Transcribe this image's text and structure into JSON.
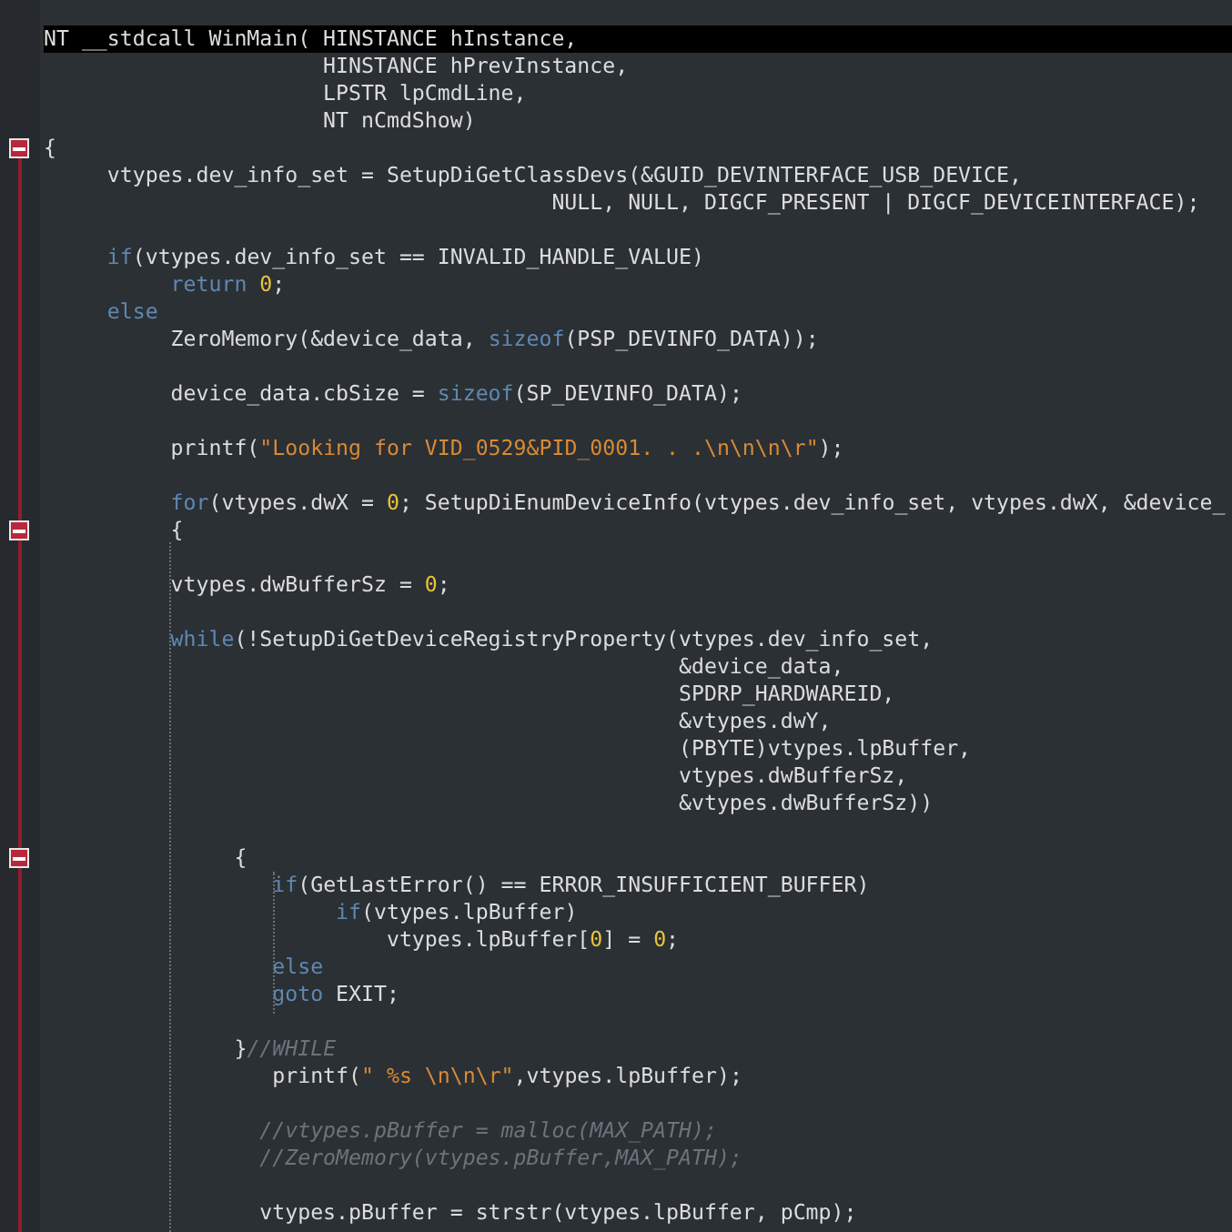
{
  "editor": {
    "lines": [
      {
        "kind": "code",
        "fold": false,
        "current": true,
        "tokens": [
          {
            "kind": "text",
            "text": "NT __stdcall WinMain( HINSTANCE hInstance,"
          }
        ]
      },
      {
        "kind": "code",
        "fold": false,
        "current": false,
        "tokens": [
          {
            "kind": "text",
            "text": "                      HINSTANCE hPrevInstance,"
          }
        ]
      },
      {
        "kind": "code",
        "fold": false,
        "current": false,
        "tokens": [
          {
            "kind": "text",
            "text": "                      LPSTR lpCmdLine,"
          }
        ]
      },
      {
        "kind": "code",
        "fold": false,
        "current": false,
        "tokens": [
          {
            "kind": "text",
            "text": "                      NT nCmdShow)"
          }
        ]
      },
      {
        "kind": "code",
        "fold": true,
        "current": false,
        "tokens": [
          {
            "kind": "text",
            "text": "{"
          }
        ]
      },
      {
        "kind": "code",
        "fold": false,
        "current": false,
        "tokens": [
          {
            "kind": "text",
            "text": "     vtypes.dev_info_set = SetupDiGetClassDevs(&GUID_DEVINTERFACE_USB_DEVICE,"
          }
        ]
      },
      {
        "kind": "code",
        "fold": false,
        "current": false,
        "tokens": [
          {
            "kind": "text",
            "text": "                                        NULL, NULL, DIGCF_PRESENT | DIGCF_DEVICEINTERFACE);"
          }
        ]
      },
      {
        "kind": "blank",
        "fold": false,
        "current": false
      },
      {
        "kind": "code",
        "fold": false,
        "current": false,
        "tokens": [
          {
            "kind": "keyword",
            "text": "     if"
          },
          {
            "kind": "text",
            "text": "(vtypes.dev_info_set == INVALID_HANDLE_VALUE)"
          }
        ]
      },
      {
        "kind": "code",
        "fold": false,
        "current": false,
        "tokens": [
          {
            "kind": "keyword",
            "text": "          return "
          },
          {
            "kind": "number",
            "text": "0"
          },
          {
            "kind": "text",
            "text": ";"
          }
        ]
      },
      {
        "kind": "code",
        "fold": false,
        "current": false,
        "tokens": [
          {
            "kind": "keyword",
            "text": "     else"
          }
        ]
      },
      {
        "kind": "code",
        "fold": false,
        "current": false,
        "tokens": [
          {
            "kind": "text",
            "text": "          ZeroMemory(&device_data, "
          },
          {
            "kind": "keyword",
            "text": "sizeof"
          },
          {
            "kind": "text",
            "text": "(PSP_DEVINFO_DATA));"
          }
        ]
      },
      {
        "kind": "blank",
        "fold": false,
        "current": false
      },
      {
        "kind": "code",
        "fold": false,
        "current": false,
        "tokens": [
          {
            "kind": "text",
            "text": "          device_data.cbSize = "
          },
          {
            "kind": "keyword",
            "text": "sizeof"
          },
          {
            "kind": "text",
            "text": "(SP_DEVINFO_DATA);"
          }
        ]
      },
      {
        "kind": "blank",
        "fold": false,
        "current": false
      },
      {
        "kind": "code",
        "fold": false,
        "current": false,
        "tokens": [
          {
            "kind": "text",
            "text": "          printf("
          },
          {
            "kind": "string",
            "text": "\"Looking for VID_0529&PID_0001. . .\\n\\n\\n\\r\""
          },
          {
            "kind": "text",
            "text": ");"
          }
        ]
      },
      {
        "kind": "blank",
        "fold": false,
        "current": false
      },
      {
        "kind": "code",
        "fold": false,
        "current": false,
        "tokens": [
          {
            "kind": "keyword",
            "text": "          for"
          },
          {
            "kind": "text",
            "text": "(vtypes.dwX = "
          },
          {
            "kind": "number",
            "text": "0"
          },
          {
            "kind": "text",
            "text": "; SetupDiEnumDeviceInfo(vtypes.dev_info_set, vtypes.dwX, &device_"
          }
        ]
      },
      {
        "kind": "code",
        "fold": true,
        "current": false,
        "tokens": [
          {
            "kind": "text",
            "text": "          {"
          }
        ]
      },
      {
        "kind": "blank",
        "fold": false,
        "current": false
      },
      {
        "kind": "code",
        "fold": false,
        "current": false,
        "tokens": [
          {
            "kind": "text",
            "text": "          vtypes.dwBufferSz = "
          },
          {
            "kind": "number",
            "text": "0"
          },
          {
            "kind": "text",
            "text": ";"
          }
        ]
      },
      {
        "kind": "blank",
        "fold": false,
        "current": false
      },
      {
        "kind": "code",
        "fold": false,
        "current": false,
        "tokens": [
          {
            "kind": "keyword",
            "text": "          while"
          },
          {
            "kind": "text",
            "text": "(!SetupDiGetDeviceRegistryProperty(vtypes.dev_info_set,"
          }
        ]
      },
      {
        "kind": "code",
        "fold": false,
        "current": false,
        "tokens": [
          {
            "kind": "text",
            "text": "                                                  &device_data,"
          }
        ]
      },
      {
        "kind": "code",
        "fold": false,
        "current": false,
        "tokens": [
          {
            "kind": "text",
            "text": "                                                  SPDRP_HARDWAREID,"
          }
        ]
      },
      {
        "kind": "code",
        "fold": false,
        "current": false,
        "tokens": [
          {
            "kind": "text",
            "text": "                                                  &vtypes.dwY,"
          }
        ]
      },
      {
        "kind": "code",
        "fold": false,
        "current": false,
        "tokens": [
          {
            "kind": "text",
            "text": "                                                  (PBYTE)vtypes.lpBuffer,"
          }
        ]
      },
      {
        "kind": "code",
        "fold": false,
        "current": false,
        "tokens": [
          {
            "kind": "text",
            "text": "                                                  vtypes.dwBufferSz,"
          }
        ]
      },
      {
        "kind": "code",
        "fold": false,
        "current": false,
        "tokens": [
          {
            "kind": "text",
            "text": "                                                  &vtypes.dwBufferSz))"
          }
        ]
      },
      {
        "kind": "blank",
        "fold": false,
        "current": false
      },
      {
        "kind": "code",
        "fold": true,
        "current": false,
        "tokens": [
          {
            "kind": "text",
            "text": "               {"
          }
        ]
      },
      {
        "kind": "code",
        "fold": false,
        "current": false,
        "tokens": [
          {
            "kind": "keyword",
            "text": "                  if"
          },
          {
            "kind": "text",
            "text": "(GetLastError() == ERROR_INSUFFICIENT_BUFFER)"
          }
        ]
      },
      {
        "kind": "code",
        "fold": false,
        "current": false,
        "tokens": [
          {
            "kind": "keyword",
            "text": "                       if"
          },
          {
            "kind": "text",
            "text": "(vtypes.lpBuffer)"
          }
        ]
      },
      {
        "kind": "code",
        "fold": false,
        "current": false,
        "tokens": [
          {
            "kind": "text",
            "text": "                           vtypes.lpBuffer["
          },
          {
            "kind": "number",
            "text": "0"
          },
          {
            "kind": "text",
            "text": "] = "
          },
          {
            "kind": "number",
            "text": "0"
          },
          {
            "kind": "text",
            "text": ";"
          }
        ]
      },
      {
        "kind": "code",
        "fold": false,
        "current": false,
        "tokens": [
          {
            "kind": "keyword",
            "text": "                  else"
          }
        ]
      },
      {
        "kind": "code",
        "fold": false,
        "current": false,
        "tokens": [
          {
            "kind": "keyword",
            "text": "                  goto"
          },
          {
            "kind": "text",
            "text": " EXIT;"
          }
        ]
      },
      {
        "kind": "blank",
        "fold": false,
        "current": false
      },
      {
        "kind": "code",
        "fold": false,
        "current": false,
        "tokens": [
          {
            "kind": "text",
            "text": "               }"
          },
          {
            "kind": "comment",
            "text": "//WHILE"
          }
        ]
      },
      {
        "kind": "code",
        "fold": false,
        "current": false,
        "tokens": [
          {
            "kind": "text",
            "text": "                  printf("
          },
          {
            "kind": "string",
            "text": "\" %s \\n\\n\\r\""
          },
          {
            "kind": "text",
            "text": ",vtypes.lpBuffer);"
          }
        ]
      },
      {
        "kind": "blank",
        "fold": false,
        "current": false
      },
      {
        "kind": "code",
        "fold": false,
        "current": false,
        "tokens": [
          {
            "kind": "comment",
            "text": "                 //vtypes.pBuffer = malloc(MAX_PATH);"
          }
        ]
      },
      {
        "kind": "code",
        "fold": false,
        "current": false,
        "tokens": [
          {
            "kind": "comment",
            "text": "                 //ZeroMemory(vtypes.pBuffer,MAX_PATH);"
          }
        ]
      },
      {
        "kind": "blank",
        "fold": false,
        "current": false
      },
      {
        "kind": "code",
        "fold": false,
        "current": false,
        "tokens": [
          {
            "kind": "text",
            "text": "                 vtypes.pBuffer = strstr(vtypes.lpBuffer, pCmp);"
          }
        ]
      }
    ]
  }
}
